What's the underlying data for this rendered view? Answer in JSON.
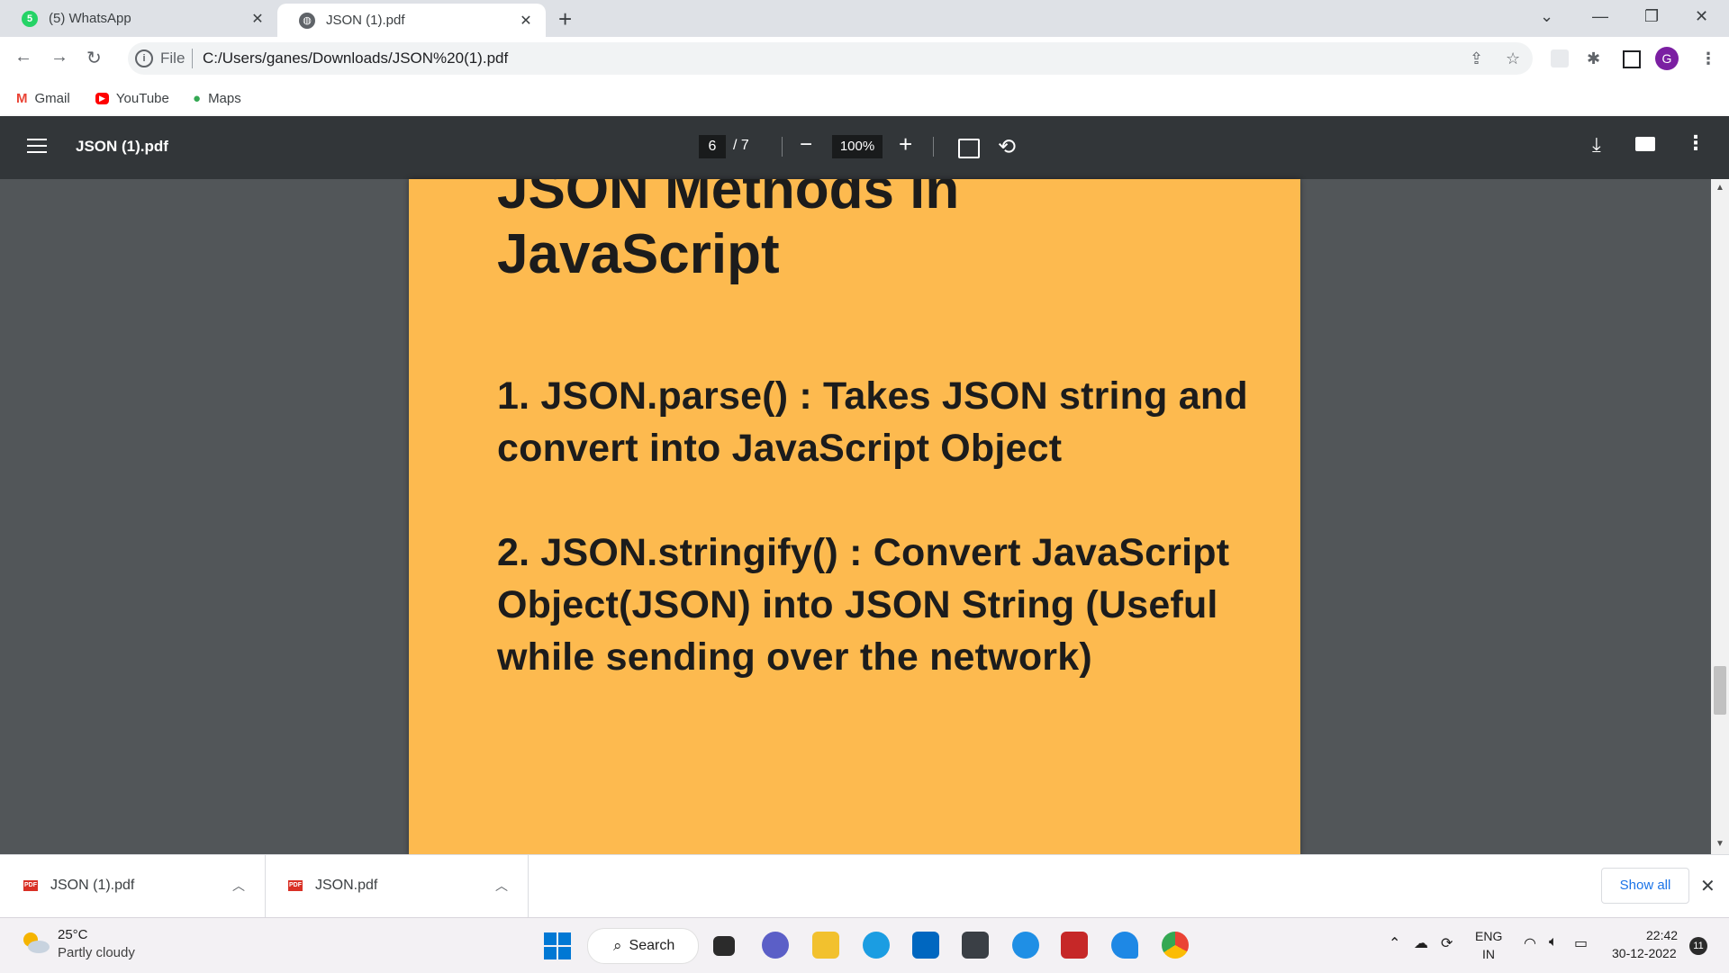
{
  "tabs": [
    {
      "badge": "5",
      "title": "(5) WhatsApp"
    },
    {
      "title": "JSON (1).pdf"
    }
  ],
  "omnibox": {
    "scheme_label": "File",
    "url": "C:/Users/ganes/Downloads/JSON%20(1).pdf"
  },
  "profile_initial": "G",
  "bookmarks": [
    {
      "label": "Gmail"
    },
    {
      "label": "YouTube"
    },
    {
      "label": "Maps"
    }
  ],
  "pdf_toolbar": {
    "title": "JSON (1).pdf",
    "current_page": "6",
    "total_pages": "/ 7",
    "zoom": "100%"
  },
  "pdf_page": {
    "heading": "JSON Methods in JavaScript",
    "para1": "1. JSON.parse() : Takes JSON string and convert into JavaScript Object",
    "para2": "2. JSON.stringify() : Convert JavaScript Object(JSON) into JSON String (Useful while sending over the network)",
    "background": "#fdba4f"
  },
  "downloads": [
    {
      "name": "JSON (1).pdf",
      "icon_label": "PDF"
    },
    {
      "name": "JSON.pdf",
      "icon_label": "PDF"
    }
  ],
  "show_all_label": "Show all",
  "taskbar": {
    "weather_temp": "25°C",
    "weather_desc": "Partly cloudy",
    "search_label": "Search",
    "lang_line1": "ENG",
    "lang_line2": "IN",
    "time": "22:42",
    "date": "30-12-2022",
    "notification_count": "11"
  }
}
